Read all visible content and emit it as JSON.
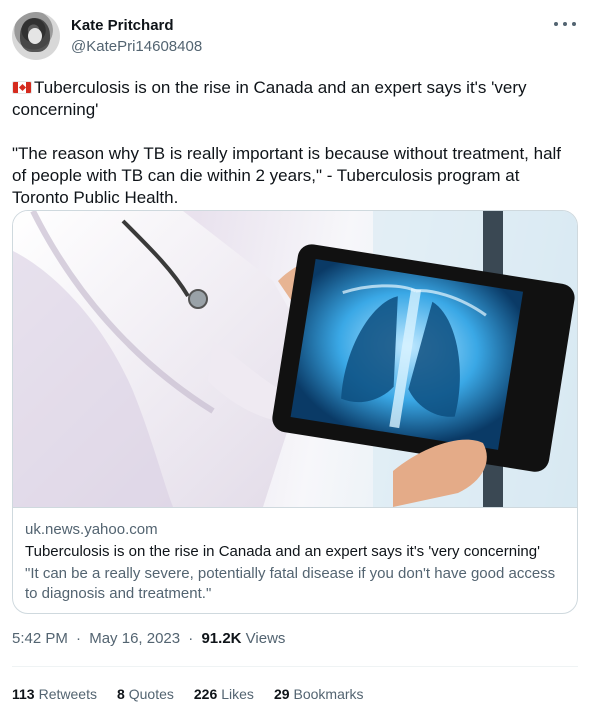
{
  "author": {
    "display_name": "Kate Pritchard",
    "handle": "@KatePri14608408"
  },
  "icons": {
    "avatar": "avatar-photo",
    "more": "more-horizontal-icon",
    "flag": "canada-flag-icon"
  },
  "tweet": {
    "line1": "Tuberculosis is on the rise in Canada and an expert says it's 'very concerning'",
    "line2": "\"The reason why TB is really important is because without treatment, half of people with TB can die within 2 years,\" - Tuberculosis program at Toronto Public Health."
  },
  "card": {
    "domain": "uk.news.yahoo.com",
    "title": "Tuberculosis is on the rise in Canada and an expert says it's 'very concerning'",
    "description": "\"It can be a really severe, potentially fatal disease if you don't have good access to diagnosis and treatment.\"",
    "image": "doctor holding tablet showing chest x-ray"
  },
  "meta": {
    "time": "5:42 PM",
    "separator": "·",
    "date": "May 16, 2023",
    "views_count": "91.2K",
    "views_label": "Views"
  },
  "stats": [
    {
      "count": "113",
      "label": "Retweets"
    },
    {
      "count": "8",
      "label": "Quotes"
    },
    {
      "count": "226",
      "label": "Likes"
    },
    {
      "count": "29",
      "label": "Bookmarks"
    }
  ],
  "colors": {
    "text": "#0f1419",
    "secondary": "#536471",
    "border": "#cfd9de"
  }
}
